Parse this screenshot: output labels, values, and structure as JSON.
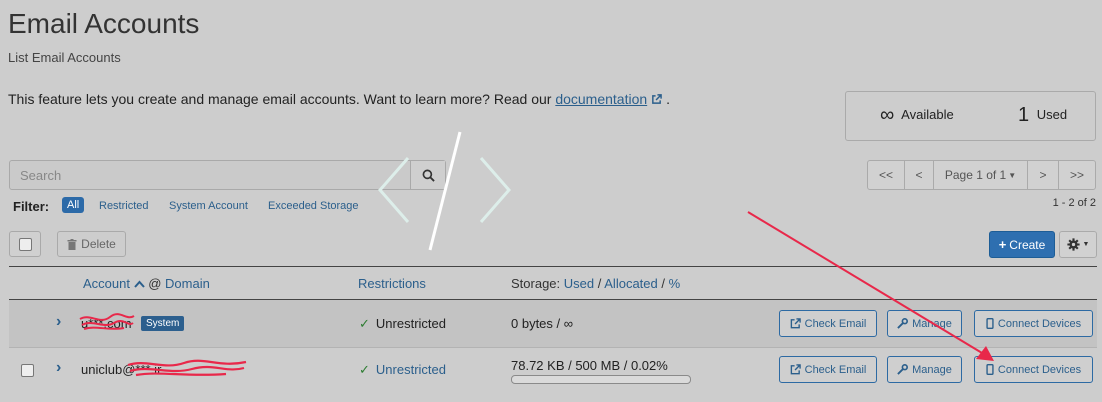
{
  "page": {
    "title": "Email Accounts",
    "subtitle": "List Email Accounts",
    "intro_text": "This feature lets you create and manage email accounts. Want to learn more? Read our ",
    "intro_link": "documentation",
    "intro_end": "."
  },
  "stats": {
    "available_value": "∞",
    "available_label": "Available",
    "used_value": "1",
    "used_label": "Used"
  },
  "search": {
    "placeholder": "Search"
  },
  "filters": {
    "label": "Filter:",
    "items": [
      "All",
      "Restricted",
      "System Account",
      "Exceeded Storage"
    ],
    "active": "All"
  },
  "pagination": {
    "first": "<<",
    "prev": "<",
    "page": "Page 1 of 1",
    "next": ">",
    "last": ">>",
    "range": "1 - 2 of 2"
  },
  "toolbar": {
    "delete_label": "Delete",
    "create_label": "Create"
  },
  "table": {
    "headers": {
      "account": "Account",
      "domain": "Domain",
      "restrictions": "Restrictions",
      "storage_prefix": "Storage:",
      "used": "Used",
      "allocated": "Allocated",
      "percent": "%"
    },
    "rows": [
      {
        "account": "u***.com",
        "badge": "System",
        "restriction": "Unrestricted",
        "storage": "0 bytes / ∞",
        "check_email": "Check Email",
        "manage": "Manage",
        "connect": "Connect Devices"
      },
      {
        "account": "uniclub@***.ir",
        "restriction": "Unrestricted",
        "storage": "78.72 KB / 500 MB / 0.02%",
        "usage_fraction": 0.0002,
        "check_email": "Check Email",
        "manage": "Manage",
        "connect": "Connect Devices"
      }
    ]
  },
  "colors": {
    "background": "#cdcdcd",
    "link": "#2b5f8c",
    "primary": "#2e6fb0",
    "success": "#2e7d32",
    "annotation_arrow": "#e8284a"
  }
}
